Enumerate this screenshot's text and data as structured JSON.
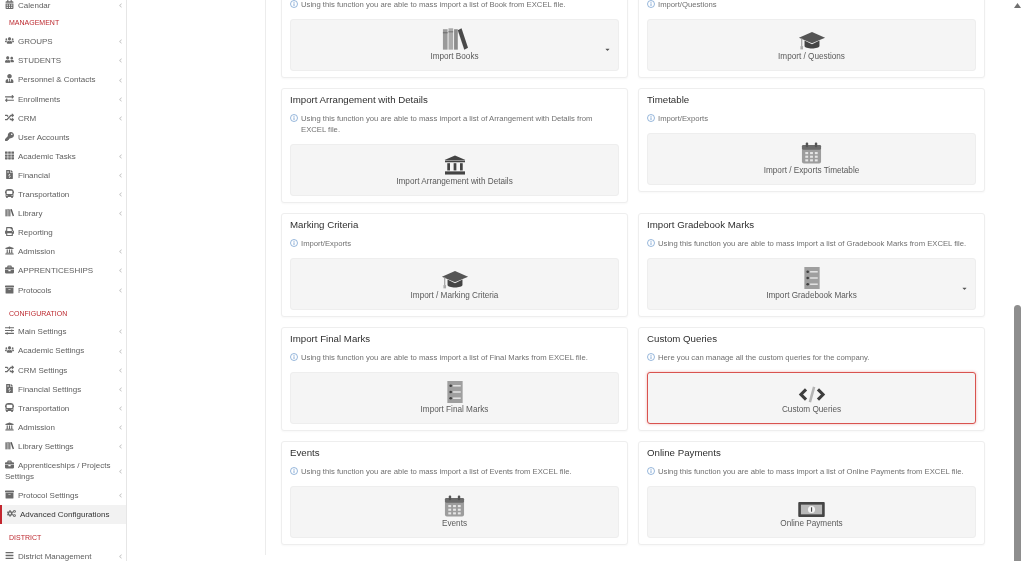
{
  "sidebar": {
    "sections": [
      {
        "items": [
          {
            "label": "Calendar",
            "expandable": true,
            "selected": false
          }
        ]
      },
      {
        "heading": "MANAGEMENT",
        "items": [
          {
            "label": "GROUPS",
            "expandable": true,
            "selected": false
          },
          {
            "label": "STUDENTS",
            "expandable": true,
            "selected": false
          },
          {
            "label": "Personnel & Contacts",
            "expandable": true,
            "selected": false
          },
          {
            "label": "Enrollments",
            "expandable": true,
            "selected": false
          },
          {
            "label": "CRM",
            "expandable": true,
            "selected": false
          },
          {
            "label": "User Accounts",
            "expandable": false,
            "selected": false
          },
          {
            "label": "Academic Tasks",
            "expandable": true,
            "selected": false
          },
          {
            "label": "Financial",
            "expandable": true,
            "selected": false
          },
          {
            "label": "Transportation",
            "expandable": true,
            "selected": false
          },
          {
            "label": "Library",
            "expandable": true,
            "selected": false
          },
          {
            "label": "Reporting",
            "expandable": false,
            "selected": false
          },
          {
            "label": "Admission",
            "expandable": true,
            "selected": false
          },
          {
            "label": "APPRENTICESHIPS",
            "expandable": true,
            "selected": false
          },
          {
            "label": "Protocols",
            "expandable": true,
            "selected": false
          }
        ]
      },
      {
        "heading": "CONFIGURATION",
        "items": [
          {
            "label": "Main Settings",
            "expandable": true,
            "selected": false
          },
          {
            "label": "Academic Settings",
            "expandable": true,
            "selected": false
          },
          {
            "label": "CRM Settings",
            "expandable": true,
            "selected": false
          },
          {
            "label": "Financial Settings",
            "expandable": true,
            "selected": false
          },
          {
            "label": "Transportation",
            "expandable": true,
            "selected": false
          },
          {
            "label": "Admission",
            "expandable": true,
            "selected": false
          },
          {
            "label": "Library Settings",
            "expandable": true,
            "selected": false
          },
          {
            "label": "Apprenticeships / Projects Settings",
            "expandable": true,
            "selected": false
          },
          {
            "label": "Protocol Settings",
            "expandable": true,
            "selected": false
          },
          {
            "label": "Advanced Configurations",
            "expandable": false,
            "selected": true
          }
        ]
      },
      {
        "heading": "DISTRICT",
        "items": [
          {
            "label": "District Management",
            "expandable": true,
            "selected": false
          }
        ]
      }
    ]
  },
  "cards": [
    {
      "description": "Using this function you are able to mass import a list of Book from EXCEL file.",
      "action": {
        "label": "Import Books",
        "dropdown": true,
        "highlighted": false
      }
    },
    {
      "description": "Import/Questions",
      "action": {
        "label": "Import / Questions",
        "dropdown": false,
        "highlighted": false
      }
    },
    {
      "title": "Import Arrangement with Details",
      "description": "Using this function you are able to mass import a list of Arrangement with Details from EXCEL file.",
      "action": {
        "label": "Import Arrangement with Details",
        "dropdown": false,
        "highlighted": false
      }
    },
    {
      "title": "Timetable",
      "description": "Import/Exports",
      "action": {
        "label": "Import / Exports Timetable",
        "dropdown": false,
        "highlighted": false
      }
    },
    {
      "title": "Marking Criteria",
      "description": "Import/Exports",
      "action": {
        "label": "Import / Marking Criteria",
        "dropdown": false,
        "highlighted": false
      }
    },
    {
      "title": "Import Gradebook Marks",
      "description": "Using this function you are able to mass import a list of Gradebook Marks from EXCEL file.",
      "action": {
        "label": "Import Gradebook Marks",
        "dropdown": true,
        "highlighted": false
      }
    },
    {
      "title": "Import Final Marks",
      "description": "Using this function you are able to mass import a list of Final Marks from EXCEL file.",
      "action": {
        "label": "Import Final Marks",
        "dropdown": false,
        "highlighted": false
      }
    },
    {
      "title": "Custom Queries",
      "description": "Here you can manage all the custom queries for the company.",
      "action": {
        "label": "Custom Queries",
        "dropdown": false,
        "highlighted": true
      }
    },
    {
      "title": "Events",
      "description": "Using this function you are able to mass import a list of Events from EXCEL file.",
      "action": {
        "label": "Events",
        "dropdown": false,
        "highlighted": false
      }
    },
    {
      "title": "Online Payments",
      "description": "Using this function you are able to mass import a list of Online Payments from EXCEL file.",
      "action": {
        "label": "Online Payments",
        "dropdown": false,
        "highlighted": false
      }
    }
  ]
}
